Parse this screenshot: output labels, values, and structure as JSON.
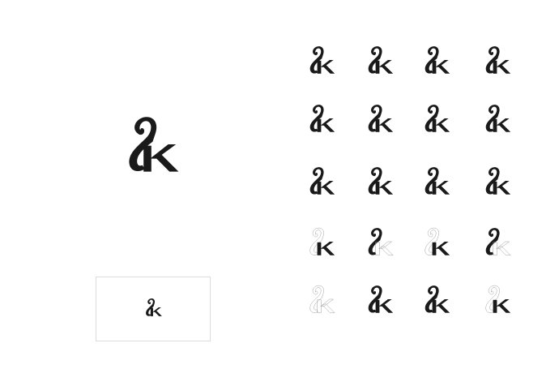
{
  "colors": {
    "ink": "#1a1a1a",
    "outline": "#9a9a9a",
    "frame": "#dcdcdc",
    "background": "#ffffff"
  },
  "hero_glyph": {
    "icon": "ampersand-k-ligature-icon",
    "style": "solid"
  },
  "preview_glyph": {
    "icon": "ampersand-k-ligature-icon",
    "style": "solid"
  },
  "variants": [
    {
      "icon": "ampersand-k-ligature-icon",
      "style": "solid"
    },
    {
      "icon": "ampersand-k-ligature-icon",
      "style": "solid"
    },
    {
      "icon": "ampersand-k-ligature-icon",
      "style": "solid"
    },
    {
      "icon": "ampersand-k-ligature-icon",
      "style": "solid"
    },
    {
      "icon": "ampersand-k-ligature-icon",
      "style": "solid"
    },
    {
      "icon": "ampersand-k-ligature-icon",
      "style": "solid"
    },
    {
      "icon": "ampersand-k-ligature-icon",
      "style": "solid"
    },
    {
      "icon": "ampersand-k-ligature-icon",
      "style": "solid"
    },
    {
      "icon": "ampersand-k-ligature-icon",
      "style": "solid"
    },
    {
      "icon": "ampersand-k-ligature-icon",
      "style": "solid"
    },
    {
      "icon": "ampersand-k-ligature-icon",
      "style": "solid"
    },
    {
      "icon": "ampersand-k-ligature-icon",
      "style": "solid"
    },
    {
      "icon": "ampersand-k-ligature-icon",
      "style": "outline-top"
    },
    {
      "icon": "ampersand-k-ligature-icon",
      "style": "outline-bottom"
    },
    {
      "icon": "ampersand-k-ligature-icon",
      "style": "outline-top"
    },
    {
      "icon": "ampersand-k-ligature-icon",
      "style": "outline-bottom"
    },
    {
      "icon": "ampersand-k-ligature-icon",
      "style": "outline"
    },
    {
      "icon": "ampersand-k-ligature-icon",
      "style": "solid"
    },
    {
      "icon": "ampersand-k-ligature-icon",
      "style": "solid"
    },
    {
      "icon": "ampersand-k-ligature-icon",
      "style": "outline-top"
    }
  ]
}
